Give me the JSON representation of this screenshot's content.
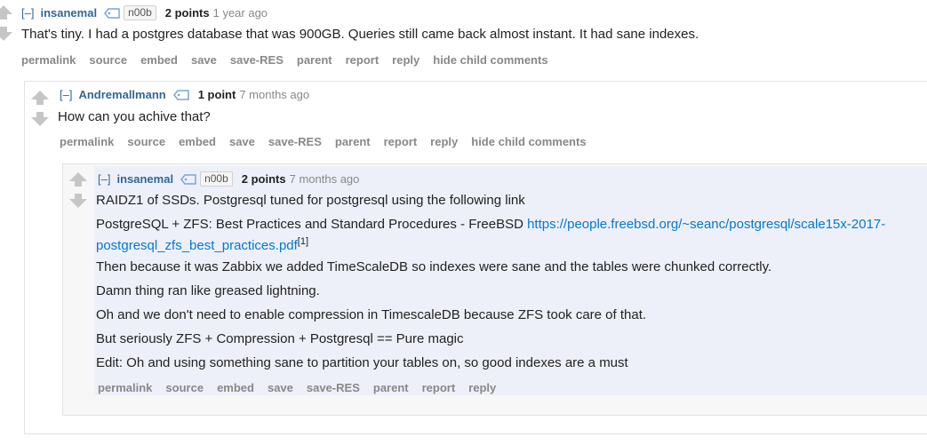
{
  "comment1": {
    "expand": "[–]",
    "author": "insanemal",
    "flair": "n00b",
    "score": "2 points",
    "time": "1 year ago",
    "body": "That's tiny. I had a postgres database that was 900GB. Queries still came back almost instant. It had sane indexes.",
    "buttons": [
      "permalink",
      "source",
      "embed",
      "save",
      "save-RES",
      "parent",
      "report",
      "reply",
      "hide child comments"
    ]
  },
  "comment2": {
    "expand": "[–]",
    "author": "Andremallmann",
    "score": "1 point",
    "time": "7 months ago",
    "body": "How can you achive that?",
    "buttons": [
      "permalink",
      "source",
      "embed",
      "save",
      "save-RES",
      "parent",
      "report",
      "reply",
      "hide child comments"
    ]
  },
  "comment3": {
    "expand": "[–]",
    "author": "insanemal",
    "flair": "n00b",
    "score": "2 points",
    "time": "7 months ago",
    "p1": "RAIDZ1 of SSDs. Postgresql tuned for postgresql using the following link",
    "p2_text": "PostgreSQL + ZFS: Best Practices and Standard Procedures - FreeBSD ",
    "p2_link_line1": "https://people.freebsd.org/~seanc/postgresql/scale15x-2017-",
    "p2_link_line2": "postgresql_zfs_best_practices.pdf",
    "p2_sup": "[1]",
    "p3": "Then because it was Zabbix we added TimeScaleDB so indexes were sane and the tables were chunked correctly.",
    "p4": "Damn thing ran like greased lightning.",
    "p5": "Oh and we don't need to enable compression in TimescaleDB because ZFS took care of that.",
    "p6": "But seriously ZFS + Compression + Postgresql == Pure magic",
    "p7": "Edit: Oh and using something sane to partition your tables on, so good indexes are a must",
    "buttons": [
      "permalink",
      "source",
      "embed",
      "save",
      "save-RES",
      "parent",
      "report",
      "reply"
    ]
  },
  "colors": {
    "link": "#0079d3",
    "author": "#336699",
    "child_bg": "#eef0f9",
    "arrow": "#c6c6c6"
  }
}
